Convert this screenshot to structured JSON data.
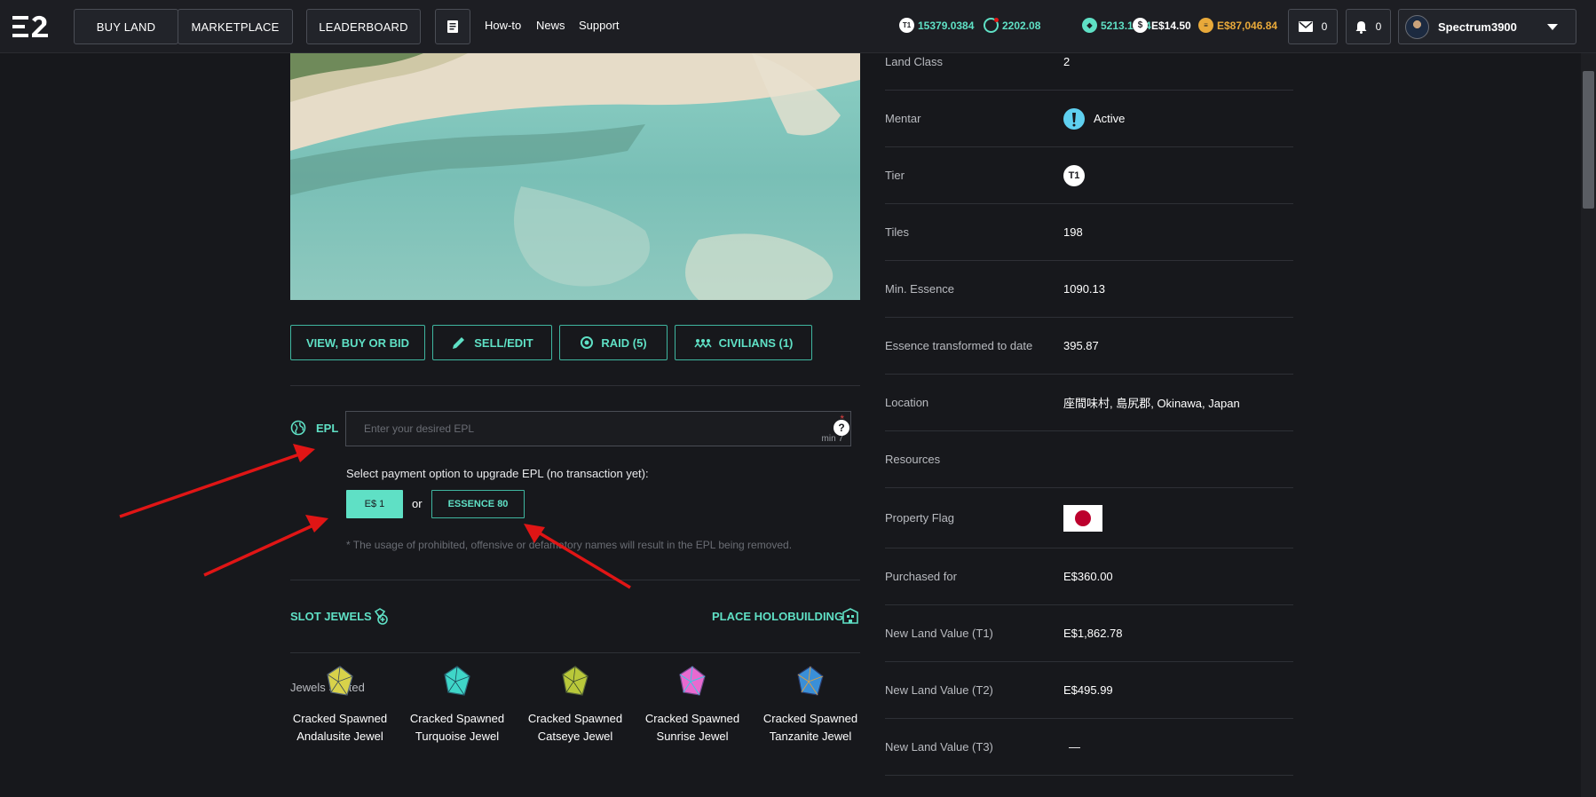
{
  "nav": {
    "buy_land": "BUY LAND",
    "marketplace": "MARKETPLACE",
    "leaderboard": "LEADERBOARD",
    "howto": "How-to",
    "news": "News",
    "support": "Support",
    "currencies": [
      {
        "icon": "T1",
        "value": "15379.0384",
        "color": "#5fe0c5"
      },
      {
        "icon": "",
        "value": "2202.08",
        "color": "#5fe0c5"
      },
      {
        "icon": "",
        "value": "5213.1954",
        "color": "#5fe0c5"
      },
      {
        "icon": "$",
        "value": "E$14.50",
        "color": "#ffffff"
      },
      {
        "icon": "",
        "value": "E$87,046.84",
        "color": "#e8a93a"
      }
    ],
    "mail_count": "0",
    "notif_count": "0",
    "username": "Spectrum3900"
  },
  "actions": {
    "view": "VIEW, BUY OR BID",
    "sell": "SELL/EDIT",
    "raid": "RAID (5)",
    "civilians": "CIVILIANS (1)"
  },
  "epl": {
    "label": "EPL",
    "placeholder": "Enter your desired EPL",
    "required_mark": "*",
    "min": "min 7",
    "help": "?",
    "payment_prompt": "Select payment option to upgrade EPL (no transaction yet):",
    "option_es": "E$ 1",
    "or": "or",
    "option_essence": "ESSENCE 80",
    "notice": "* The usage of prohibited, offensive or defamatory names will result in the EPL being removed."
  },
  "slots": {
    "slot_jewels": "SLOT JEWELS",
    "place_holo": "PLACE HOLOBUILDING",
    "jewels_slotted": "Jewels Slotted",
    "jewels": [
      {
        "line1": "Cracked Spawned",
        "line2": "Andalusite Jewel",
        "color": "#d8d24a"
      },
      {
        "line1": "Cracked Spawned",
        "line2": "Turquoise Jewel",
        "color": "#3fd6c8"
      },
      {
        "line1": "Cracked Spawned",
        "line2": "Catseye Jewel",
        "color": "#b9c83a"
      },
      {
        "line1": "Cracked Spawned",
        "line2": "Sunrise Jewel",
        "color": "#e86ad0"
      },
      {
        "line1": "Cracked Spawned",
        "line2": "Tanzanite Jewel",
        "color": "#3a8fd8"
      }
    ]
  },
  "properties": [
    {
      "label": "Land Class",
      "value": "2"
    },
    {
      "label": "Mentar",
      "value": "Active"
    },
    {
      "label": "Tier",
      "value": "T1"
    },
    {
      "label": "Tiles",
      "value": "198"
    },
    {
      "label": "Min. Essence",
      "value": "1090.13"
    },
    {
      "label": "Essence transformed to date",
      "value": "395.87"
    },
    {
      "label": "Location",
      "value": "座間味村, 島尻郡, Okinawa, Japan"
    },
    {
      "label": "Resources",
      "value": ""
    },
    {
      "label": "Property Flag",
      "value": ""
    },
    {
      "label": "Purchased for",
      "value": "E$360.00"
    },
    {
      "label": "New Land Value (T1)",
      "value": "E$1,862.78"
    },
    {
      "label": "New Land Value (T2)",
      "value": "E$495.99"
    },
    {
      "label": "New Land Value (T3)",
      "value": "—"
    }
  ]
}
